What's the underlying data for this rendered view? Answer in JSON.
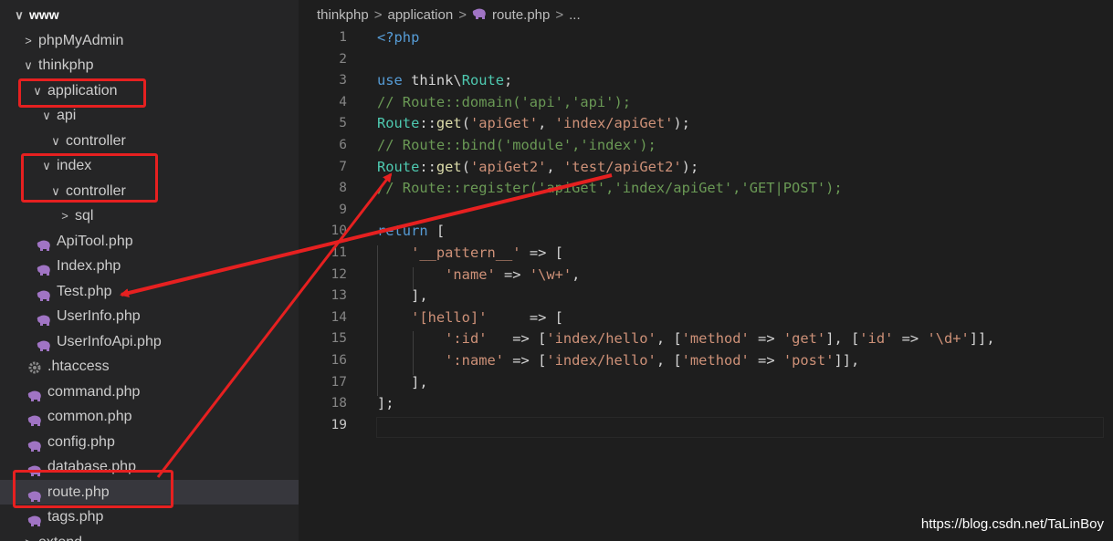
{
  "sidebar": {
    "rows": [
      {
        "label": "www",
        "chevron": "∨",
        "icon": "",
        "selected": false,
        "header": true
      },
      {
        "label": "phpMyAdmin",
        "chevron": ">",
        "icon": "",
        "selected": false,
        "header": false
      },
      {
        "label": "thinkphp",
        "chevron": "∨",
        "icon": "",
        "selected": false,
        "header": false
      },
      {
        "label": "application",
        "chevron": "∨",
        "icon": "",
        "selected": false,
        "header": false
      },
      {
        "label": "api",
        "chevron": "∨",
        "icon": "",
        "selected": false,
        "header": false
      },
      {
        "label": "controller",
        "chevron": "∨",
        "icon": "",
        "selected": false,
        "header": false
      },
      {
        "label": "index",
        "chevron": "∨",
        "icon": "",
        "selected": false,
        "header": false
      },
      {
        "label": "controller",
        "chevron": "∨",
        "icon": "",
        "selected": false,
        "header": false
      },
      {
        "label": "sql",
        "chevron": ">",
        "icon": "",
        "selected": false,
        "header": false
      },
      {
        "label": "ApiTool.php",
        "chevron": "",
        "icon": "php-elephant-icon",
        "selected": false,
        "header": false
      },
      {
        "label": "Index.php",
        "chevron": "",
        "icon": "php-elephant-icon",
        "selected": false,
        "header": false
      },
      {
        "label": "Test.php",
        "chevron": "",
        "icon": "php-elephant-icon",
        "selected": false,
        "header": false
      },
      {
        "label": "UserInfo.php",
        "chevron": "",
        "icon": "php-elephant-icon",
        "selected": false,
        "header": false
      },
      {
        "label": "UserInfoApi.php",
        "chevron": "",
        "icon": "php-elephant-icon",
        "selected": false,
        "header": false
      },
      {
        "label": ".htaccess",
        "chevron": "",
        "icon": "gear-icon",
        "selected": false,
        "header": false
      },
      {
        "label": "command.php",
        "chevron": "",
        "icon": "php-elephant-icon",
        "selected": false,
        "header": false
      },
      {
        "label": "common.php",
        "chevron": "",
        "icon": "php-elephant-icon",
        "selected": false,
        "header": false
      },
      {
        "label": "config.php",
        "chevron": "",
        "icon": "php-elephant-icon",
        "selected": false,
        "header": false
      },
      {
        "label": "database.php",
        "chevron": "",
        "icon": "php-elephant-icon",
        "selected": false,
        "header": false
      },
      {
        "label": "route.php",
        "chevron": "",
        "icon": "php-elephant-icon",
        "selected": true,
        "header": false
      },
      {
        "label": "tags.php",
        "chevron": "",
        "icon": "php-elephant-icon",
        "selected": false,
        "header": false
      },
      {
        "label": "extend",
        "chevron": ">",
        "icon": "",
        "selected": false,
        "header": false
      }
    ]
  },
  "breadcrumb": {
    "items": [
      "thinkphp",
      "application",
      "route.php",
      "..."
    ],
    "file_icon": "php-elephant-icon"
  },
  "editor": {
    "current_line": 19,
    "lines": [
      {
        "n": "1",
        "tokens": [
          [
            "tag",
            "<?php"
          ]
        ]
      },
      {
        "n": "2",
        "tokens": []
      },
      {
        "n": "3",
        "tokens": [
          [
            "kw",
            "use "
          ],
          [
            "ns",
            "think\\"
          ],
          [
            "cls",
            "Route"
          ],
          [
            "pun",
            ";"
          ]
        ]
      },
      {
        "n": "4",
        "tokens": [
          [
            "cm",
            "// Route::domain('api','api');"
          ]
        ]
      },
      {
        "n": "5",
        "tokens": [
          [
            "cls",
            "Route"
          ],
          [
            "pun",
            "::"
          ],
          [
            "fn",
            "get"
          ],
          [
            "pun",
            "("
          ],
          [
            "str",
            "'apiGet'"
          ],
          [
            "pun",
            ", "
          ],
          [
            "str",
            "'index/apiGet'"
          ],
          [
            "pun",
            ");"
          ]
        ]
      },
      {
        "n": "6",
        "tokens": [
          [
            "cm",
            "// Route::bind('module','index');"
          ]
        ]
      },
      {
        "n": "7",
        "tokens": [
          [
            "cls",
            "Route"
          ],
          [
            "pun",
            "::"
          ],
          [
            "fn",
            "get"
          ],
          [
            "pun",
            "("
          ],
          [
            "str",
            "'apiGet2'"
          ],
          [
            "pun",
            ", "
          ],
          [
            "str",
            "'test/apiGet2'"
          ],
          [
            "pun",
            ");"
          ]
        ]
      },
      {
        "n": "8",
        "tokens": [
          [
            "cm",
            "// Route::register('apiGet','index/apiGet','GET|POST');"
          ]
        ]
      },
      {
        "n": "9",
        "tokens": []
      },
      {
        "n": "10",
        "tokens": [
          [
            "kw",
            "return "
          ],
          [
            "pun",
            "["
          ]
        ]
      },
      {
        "n": "11",
        "tokens": [
          [
            "pun",
            "    "
          ],
          [
            "str",
            "'__pattern__'"
          ],
          [
            "pun",
            " => ["
          ]
        ]
      },
      {
        "n": "12",
        "tokens": [
          [
            "pun",
            "        "
          ],
          [
            "str",
            "'name'"
          ],
          [
            "pun",
            " => "
          ],
          [
            "str",
            "'\\w+'"
          ],
          [
            "pun",
            ","
          ]
        ]
      },
      {
        "n": "13",
        "tokens": [
          [
            "pun",
            "    ],"
          ]
        ]
      },
      {
        "n": "14",
        "tokens": [
          [
            "pun",
            "    "
          ],
          [
            "str",
            "'[hello]'"
          ],
          [
            "pun",
            "     => ["
          ]
        ]
      },
      {
        "n": "15",
        "tokens": [
          [
            "pun",
            "        "
          ],
          [
            "str",
            "':id'"
          ],
          [
            "pun",
            "   => ["
          ],
          [
            "str",
            "'index/hello'"
          ],
          [
            "pun",
            ", ["
          ],
          [
            "str",
            "'method'"
          ],
          [
            "pun",
            " => "
          ],
          [
            "str",
            "'get'"
          ],
          [
            "pun",
            "], ["
          ],
          [
            "str",
            "'id'"
          ],
          [
            "pun",
            " => "
          ],
          [
            "str",
            "'\\d+'"
          ],
          [
            "pun",
            "]],"
          ]
        ]
      },
      {
        "n": "16",
        "tokens": [
          [
            "pun",
            "        "
          ],
          [
            "str",
            "':name'"
          ],
          [
            "pun",
            " => ["
          ],
          [
            "str",
            "'index/hello'"
          ],
          [
            "pun",
            ", ["
          ],
          [
            "str",
            "'method'"
          ],
          [
            "pun",
            " => "
          ],
          [
            "str",
            "'post'"
          ],
          [
            "pun",
            "]],"
          ]
        ]
      },
      {
        "n": "17",
        "tokens": [
          [
            "pun",
            "    ],"
          ]
        ]
      },
      {
        "n": "18",
        "tokens": [
          [
            "pun",
            "];"
          ]
        ]
      },
      {
        "n": "19",
        "tokens": []
      }
    ]
  },
  "watermark": "https://blog.csdn.net/TaLinBoy"
}
